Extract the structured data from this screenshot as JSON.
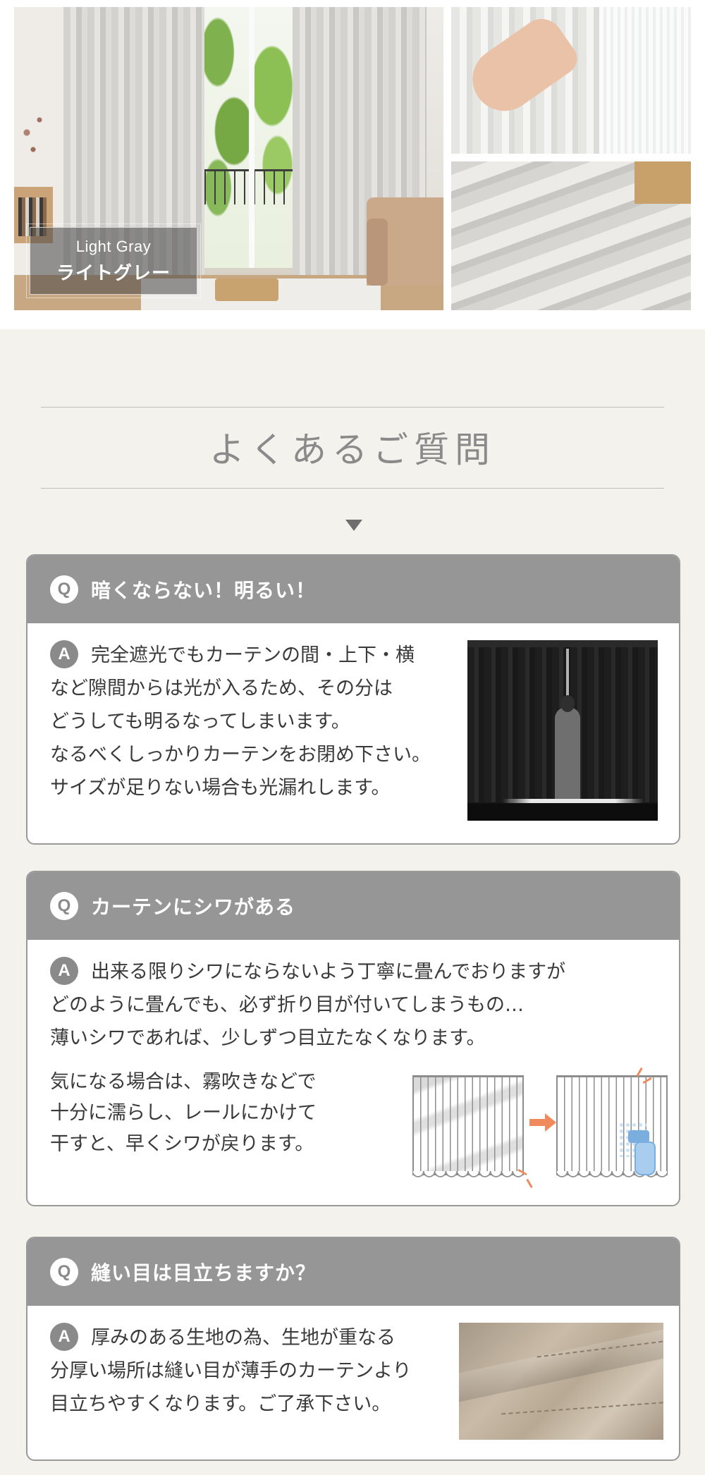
{
  "gallery": {
    "color_label_en": "Light Gray",
    "color_label_jp": "ライトグレー"
  },
  "faq": {
    "title": "よくあるご質問",
    "q_badge": "Q",
    "a_badge": "A",
    "items": [
      {
        "question": "暗くならない！明るい！",
        "answer_lines": [
          "完全遮光でもカーテンの間・上下・横",
          "など隙間からは光が入るため、その分は",
          "どうしても明るなってしまいます。",
          "なるべくしっかりカーテンをお閉め下さい。",
          "サイズが足りない場合も光漏れします。"
        ]
      },
      {
        "question": "カーテンにシワがある",
        "answer_lines": [
          "出来る限りシワにならないよう丁寧に畳んでおりますが",
          "どのように畳んでも、必ず折り目が付いてしまうもの…",
          "薄いシワであれば、少しずつ目立たなくなります。"
        ],
        "sub_lines": [
          "気になる場合は、霧吹きなどで",
          "十分に濡らし、レールにかけて",
          "干すと、早くシワが戻ります。"
        ]
      },
      {
        "question": "縫い目は目立ちますか？",
        "answer_lines": [
          "厚みのある生地の為、生地が重なる",
          "分厚い場所は縫い目が薄手のカーテンより",
          "目立ちやすくなります。ご了承下さい。"
        ]
      }
    ]
  },
  "colors": {
    "faq_background": "#f3f2ec",
    "question_bar": "#969696",
    "accent_orange": "#f08a5d",
    "spray_blue": "#7aaede"
  },
  "icons": [
    "question-badge-icon",
    "answer-badge-icon",
    "triangle-down-icon",
    "arrow-right-icon",
    "spray-bottle-icon"
  ]
}
